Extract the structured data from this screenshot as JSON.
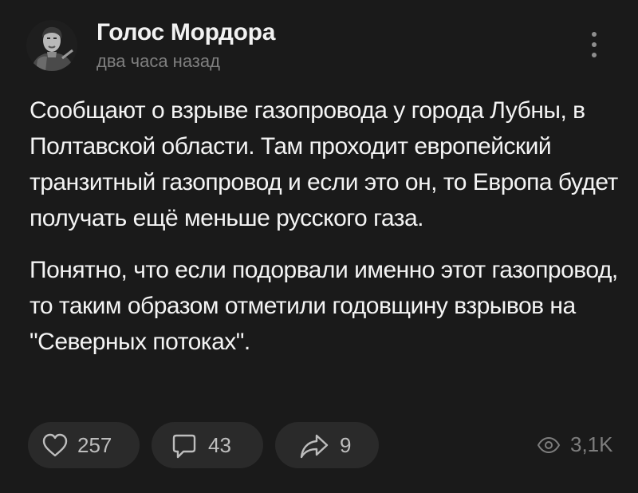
{
  "channel": {
    "name": "Голос Мордора",
    "avatar_icon": "author-portrait-icon"
  },
  "post": {
    "time": "два часа назад",
    "paragraphs": [
      "Сообщают о взрыве газопровода у города Лубны, в Полтавской области. Там проходит европейский транзитный газопровод и если это он, то Европа будет получать ещё меньше русского газа.",
      "Понятно, что если подорвали именно этот газопровод, то таким образом отметили годовщину взрывов на \"Северных потоках\"."
    ]
  },
  "actions": {
    "likes": {
      "count": "257",
      "icon": "heart-icon"
    },
    "comments": {
      "count": "43",
      "icon": "comment-icon"
    },
    "shares": {
      "count": "9",
      "icon": "share-arrow-icon"
    },
    "views": {
      "count": "3,1K",
      "icon": "eye-icon"
    }
  },
  "menu_icon": "more-vertical-icon",
  "colors": {
    "background": "#1a1a1a",
    "pill": "#2a2a2a",
    "text": "#f4f4f4",
    "muted": "#7f7f7f"
  }
}
